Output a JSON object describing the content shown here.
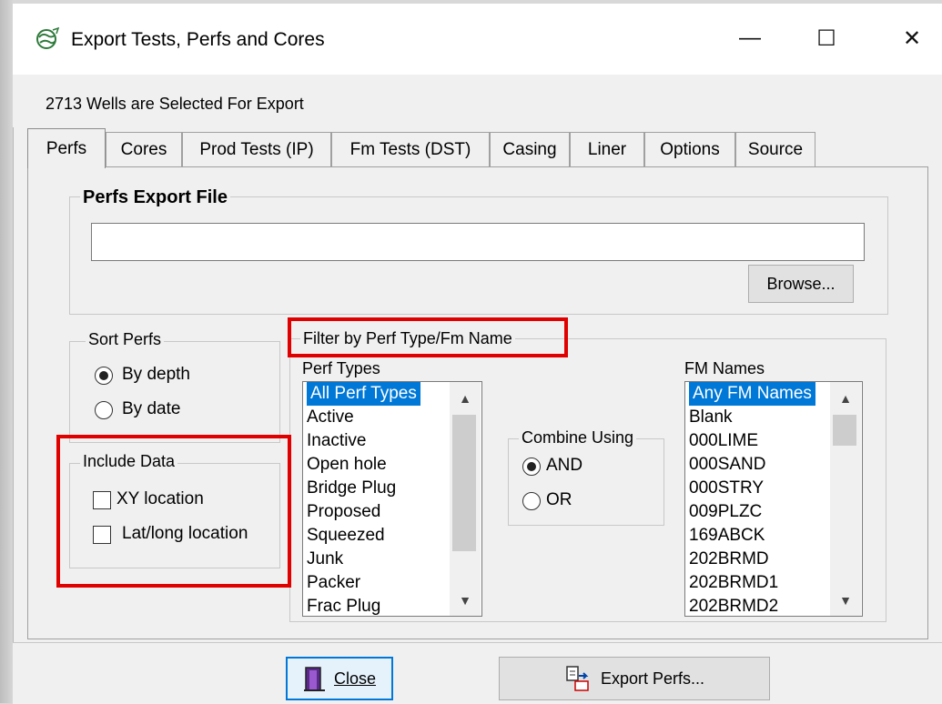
{
  "window": {
    "title": "Export Tests, Perfs and Cores",
    "minimize_glyph": "—",
    "maximize_glyph": "☐",
    "close_glyph": "✕"
  },
  "status": "2713 Wells are Selected For Export",
  "tabs": [
    "Perfs",
    "Cores",
    "Prod Tests (IP)",
    "Fm Tests (DST)",
    "Casing",
    "Liner",
    "Options",
    "Source"
  ],
  "export_file": {
    "group_label": "Perfs Export File",
    "value": "",
    "browse_label": "Browse..."
  },
  "sort": {
    "group_label": "Sort Perfs",
    "options": [
      "By depth",
      "By date"
    ],
    "selected": "By depth"
  },
  "include": {
    "group_label": "Include Data",
    "options": [
      "XY location",
      "Lat/long location"
    ]
  },
  "filter": {
    "group_label": "Filter by Perf Type/Fm Name",
    "perf_types_label": "Perf Types",
    "perf_types": [
      "All Perf Types",
      "Active",
      "Inactive",
      "Open hole",
      "Bridge Plug",
      "Proposed",
      "Squeezed",
      "Junk",
      "Packer",
      "Frac Plug"
    ],
    "combine_label": "Combine Using",
    "combine_options": [
      "AND",
      "OR"
    ],
    "combine_selected": "AND",
    "fm_names_label": "FM Names",
    "fm_names": [
      "Any FM Names",
      "Blank",
      "000LIME",
      "000SAND",
      "000STRY",
      "009PLZC",
      "169ABCK",
      "202BRMD",
      "202BRMD1",
      "202BRMD2"
    ]
  },
  "buttons": {
    "close_label": "Close",
    "export_label": "Export Perfs..."
  },
  "colors": {
    "highlight": "#e00000",
    "selection": "#0078d7"
  }
}
